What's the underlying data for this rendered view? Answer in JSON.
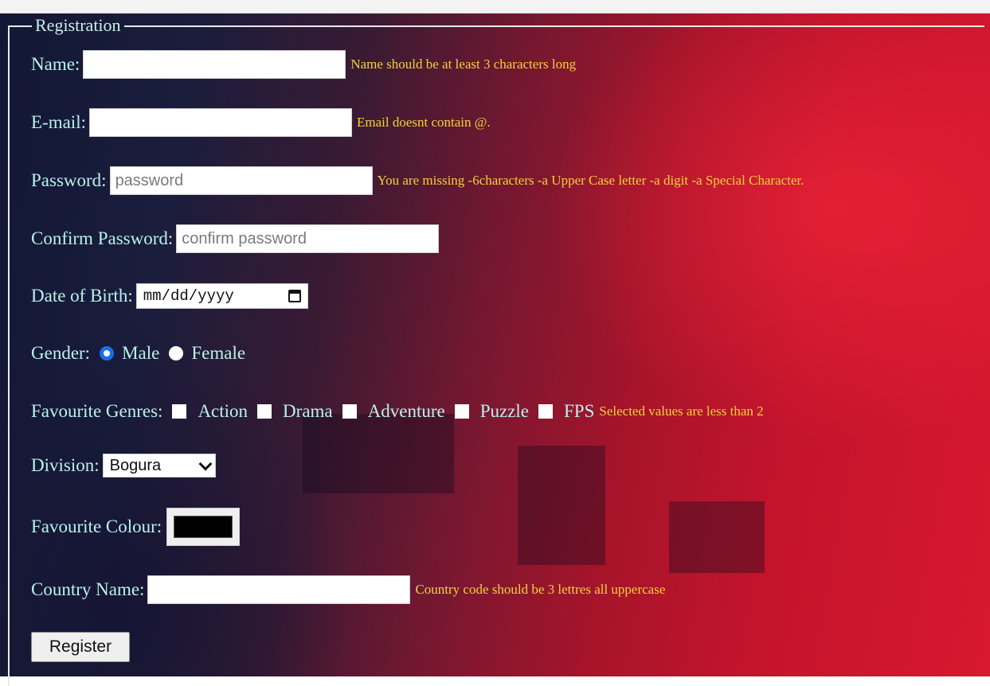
{
  "form": {
    "legend": "Registration",
    "name": {
      "label": "Name:",
      "value": "",
      "error": "Name should be at least 3 characters long"
    },
    "email": {
      "label": "E-mail:",
      "value": "",
      "error": "Email doesnt contain @."
    },
    "password": {
      "label": "Password:",
      "placeholder": "password",
      "error": "You are missing -6characters -a Upper Case letter -a digit -a Special Character."
    },
    "confirm_password": {
      "label": "Confirm Password:",
      "placeholder": "confirm password"
    },
    "dob": {
      "label": "Date of Birth:",
      "placeholder": "mm/dd/yyyy",
      "icon": "calendar-icon"
    },
    "gender": {
      "label": "Gender:",
      "options": [
        "Male",
        "Female"
      ],
      "selected": "Male"
    },
    "genres": {
      "label": "Favourite Genres:",
      "options": [
        "Action",
        "Drama",
        "Adventure",
        "Puzzle",
        "FPS"
      ],
      "error": "Selected values are less than 2"
    },
    "division": {
      "label": "Division:",
      "selected": "Bogura"
    },
    "colour": {
      "label": "Favourite Colour:",
      "value": "#000000"
    },
    "country": {
      "label": "Country Name:",
      "value": "",
      "error": "Country code should be 3 lettres all uppercase"
    },
    "register_label": "Register"
  },
  "colors": {
    "label": "#b9f2ec",
    "error": "#f2d23a",
    "radio_accent": "#1a6ee8"
  }
}
